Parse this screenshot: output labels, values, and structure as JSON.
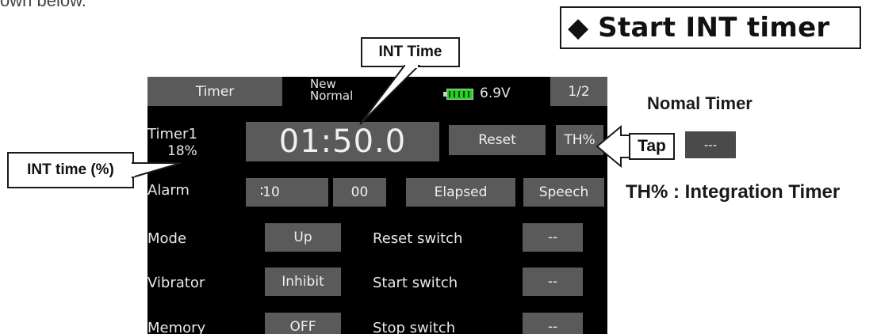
{
  "intro_text": "own below.",
  "title": {
    "symbol": "◆",
    "text": "Start INT timer"
  },
  "callouts": {
    "int_time": "INT Time",
    "int_time_pct": "INT time (%)"
  },
  "screen": {
    "header": {
      "timer_tab": "Timer",
      "model_line1": "New",
      "model_line2": "Normal",
      "voltage": "6.9V",
      "page": "1/2",
      "battery_color": "#1fd51f"
    },
    "timer_row": {
      "label": "Timer1",
      "percent": "18%",
      "time": "01:50.0",
      "reset": "Reset",
      "mode_toggle": "TH%"
    },
    "alarm_row": {
      "label": "Alarm",
      "minutes": "10",
      "separator": ":",
      "seconds": "00",
      "alarm_mode": "Elapsed",
      "alarm_type": "Speech"
    },
    "mode_row": {
      "label": "Mode",
      "value": "Up",
      "switch_label": "Reset switch",
      "switch_value": "--"
    },
    "vibrator_row": {
      "label": "Vibrator",
      "value": "Inhibit",
      "switch_label": "Start switch",
      "switch_value": "--"
    },
    "memory_row": {
      "label": "Memory",
      "value": "OFF",
      "switch_label": "Stop switch",
      "switch_value": "--"
    }
  },
  "annotations": {
    "normal_timer": "Nomal Timer",
    "tap": "Tap",
    "normal_button_value": "---",
    "integration": "TH% : Integration Timer"
  },
  "colors": {
    "screen_bg": "#000000",
    "button_bg": "#5a5a5a",
    "battery": "#1fd51f"
  }
}
